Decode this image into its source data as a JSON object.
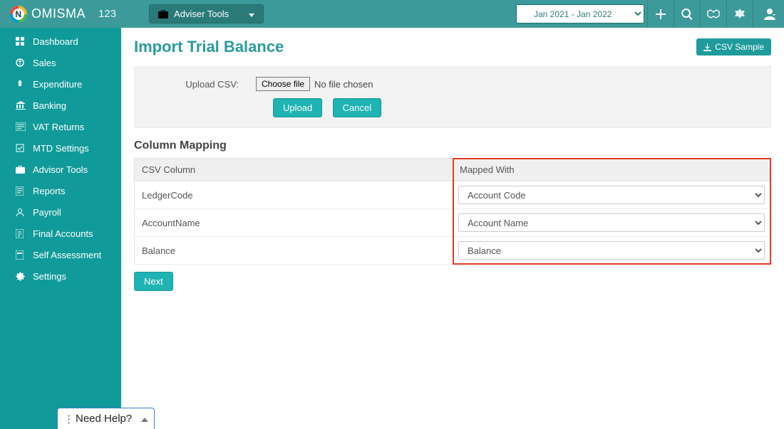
{
  "topbar": {
    "brand": "OMISMA",
    "client_code": "123",
    "adviser_tools_label": "Adviser Tools",
    "period_value": "Jan 2021 - Jan 2022"
  },
  "sidebar": {
    "items": [
      {
        "label": "Dashboard"
      },
      {
        "label": "Sales"
      },
      {
        "label": "Expenditure"
      },
      {
        "label": "Banking"
      },
      {
        "label": "VAT Returns"
      },
      {
        "label": "MTD Settings"
      },
      {
        "label": "Advisor Tools"
      },
      {
        "label": "Reports"
      },
      {
        "label": "Payroll"
      },
      {
        "label": "Final Accounts"
      },
      {
        "label": "Self Assessment"
      },
      {
        "label": "Settings"
      }
    ]
  },
  "page": {
    "title": "Import Trial Balance",
    "csv_sample_label": "CSV Sample",
    "upload_label": "Upload CSV:",
    "choose_file_label": "Choose file",
    "no_file_label": "No file chosen",
    "upload_btn": "Upload",
    "cancel_btn": "Cancel",
    "column_mapping_title": "Column Mapping",
    "csv_column_header": "CSV Column",
    "mapped_with_header": "Mapped With",
    "next_btn": "Next"
  },
  "mapping": {
    "rows": [
      {
        "csv": "LedgerCode",
        "mapped": "Account Code"
      },
      {
        "csv": "AccountName",
        "mapped": "Account Name"
      },
      {
        "csv": "Balance",
        "mapped": "Balance"
      }
    ]
  },
  "help_widget": {
    "label": "Need Help?"
  }
}
